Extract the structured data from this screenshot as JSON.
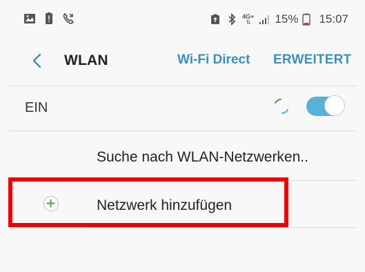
{
  "status_bar": {
    "left_icons": [
      "image-icon",
      "battery-alert-icon",
      "call-forward-icon"
    ],
    "right_icons": [
      "battery-saver-icon",
      "bluetooth-icon",
      "network-4g-icon",
      "signal-icon"
    ],
    "network_label": "4G+",
    "battery_text": "15%",
    "time_text": "15:07"
  },
  "header": {
    "back_label": "",
    "title": "WLAN",
    "actions": [
      "Wi-Fi Direct",
      "ERWEITERT"
    ]
  },
  "toggle": {
    "label": "EIN",
    "state": "on"
  },
  "list": {
    "scanning_text": "Suche nach WLAN-Netzwerken..",
    "add_label": "Netzwerk hinzufügen"
  },
  "colors": {
    "accent": "#3b8fb8",
    "toggle_on": "#56b2d8",
    "highlight_red": "#ee0000",
    "background": "#f8f8f8",
    "spinner_green": "#4caf50"
  }
}
